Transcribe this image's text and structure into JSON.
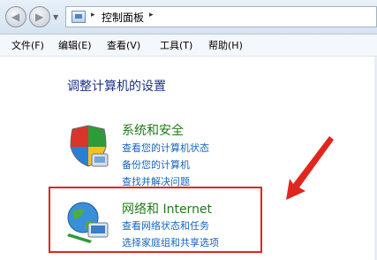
{
  "address_bar": {
    "crumb": "控制面板",
    "sep1": "▸",
    "sep2": "▸"
  },
  "menu": {
    "items": [
      "文件(F)",
      "编辑(E)",
      "查看(V)",
      "工具(T)",
      "帮助(H)"
    ]
  },
  "page_title": "调整计算机的设置",
  "categories": [
    {
      "title": "系统和安全",
      "icon": "shield-icon",
      "links": [
        "查看您的计算机状态",
        "备份您的计算机",
        "查找并解决问题"
      ]
    },
    {
      "title": "网络和 Internet",
      "icon": "network-globe-icon",
      "links": [
        "查看网络状态和任务",
        "选择家庭组和共享选项"
      ]
    }
  ],
  "annotation": {
    "box_color": "#e0261e",
    "arrow_color": "#e0261e"
  }
}
